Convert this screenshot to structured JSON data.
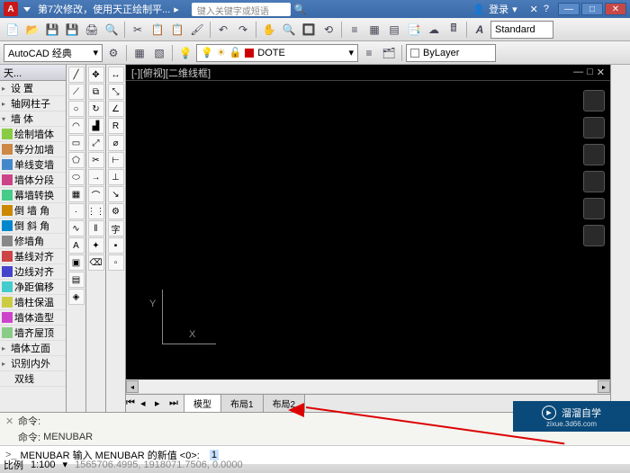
{
  "titlebar": {
    "title": "第7次修改，使用天正绘制平...",
    "search_placeholder": "键入关键字或短语",
    "login": "登录"
  },
  "toolbar2": {
    "workspace": "AutoCAD 经典",
    "layer": "DOTE",
    "linetype": "ByLayer",
    "textstyle": "Standard"
  },
  "left_panel": {
    "header": "天...",
    "items": [
      {
        "exp": "▸",
        "label": "设 置"
      },
      {
        "exp": "▸",
        "label": "轴网柱子"
      },
      {
        "exp": "▾",
        "label": "墙  体"
      },
      {
        "exp": "",
        "label": "绘制墙体"
      },
      {
        "exp": "",
        "label": "等分加墙"
      },
      {
        "exp": "",
        "label": "单线变墙"
      },
      {
        "exp": "",
        "label": "墙体分段"
      },
      {
        "exp": "",
        "label": "幕墙转换"
      },
      {
        "exp": "",
        "label": "倒 墙 角"
      },
      {
        "exp": "",
        "label": "倒 斜 角"
      },
      {
        "exp": "",
        "label": "修墙角"
      },
      {
        "exp": "",
        "label": "基线对齐"
      },
      {
        "exp": "",
        "label": "边线对齐"
      },
      {
        "exp": "",
        "label": "净距偏移"
      },
      {
        "exp": "",
        "label": "墙柱保温"
      },
      {
        "exp": "",
        "label": "墙体造型"
      },
      {
        "exp": "",
        "label": "墙齐屋顶"
      },
      {
        "exp": "▸",
        "label": "墙体立面"
      },
      {
        "exp": "▸",
        "label": "识别内外"
      },
      {
        "exp": "",
        "label": "双线"
      }
    ]
  },
  "canvas": {
    "view_label": "[-][俯视][二维线框]",
    "x_label": "X",
    "y_label": "Y"
  },
  "tabs": {
    "model": "模型",
    "layout1": "布局1",
    "layout2": "布局2"
  },
  "command": {
    "line1": "命令:",
    "line2_prefix": "命令:",
    "line2_cmd": "MENUBAR",
    "input_prefix": ">_",
    "input_text": "MENUBAR 输入 MENUBAR 的新值 <0>:",
    "input_value": "1"
  },
  "statusbar": {
    "scale_label": "比例",
    "scale_value": "1:100",
    "coords": "1565706.4995, 1918071.7506, 0.0000"
  },
  "watermark": {
    "brand": "溜溜自学",
    "url": "zixue.3d66.com"
  }
}
